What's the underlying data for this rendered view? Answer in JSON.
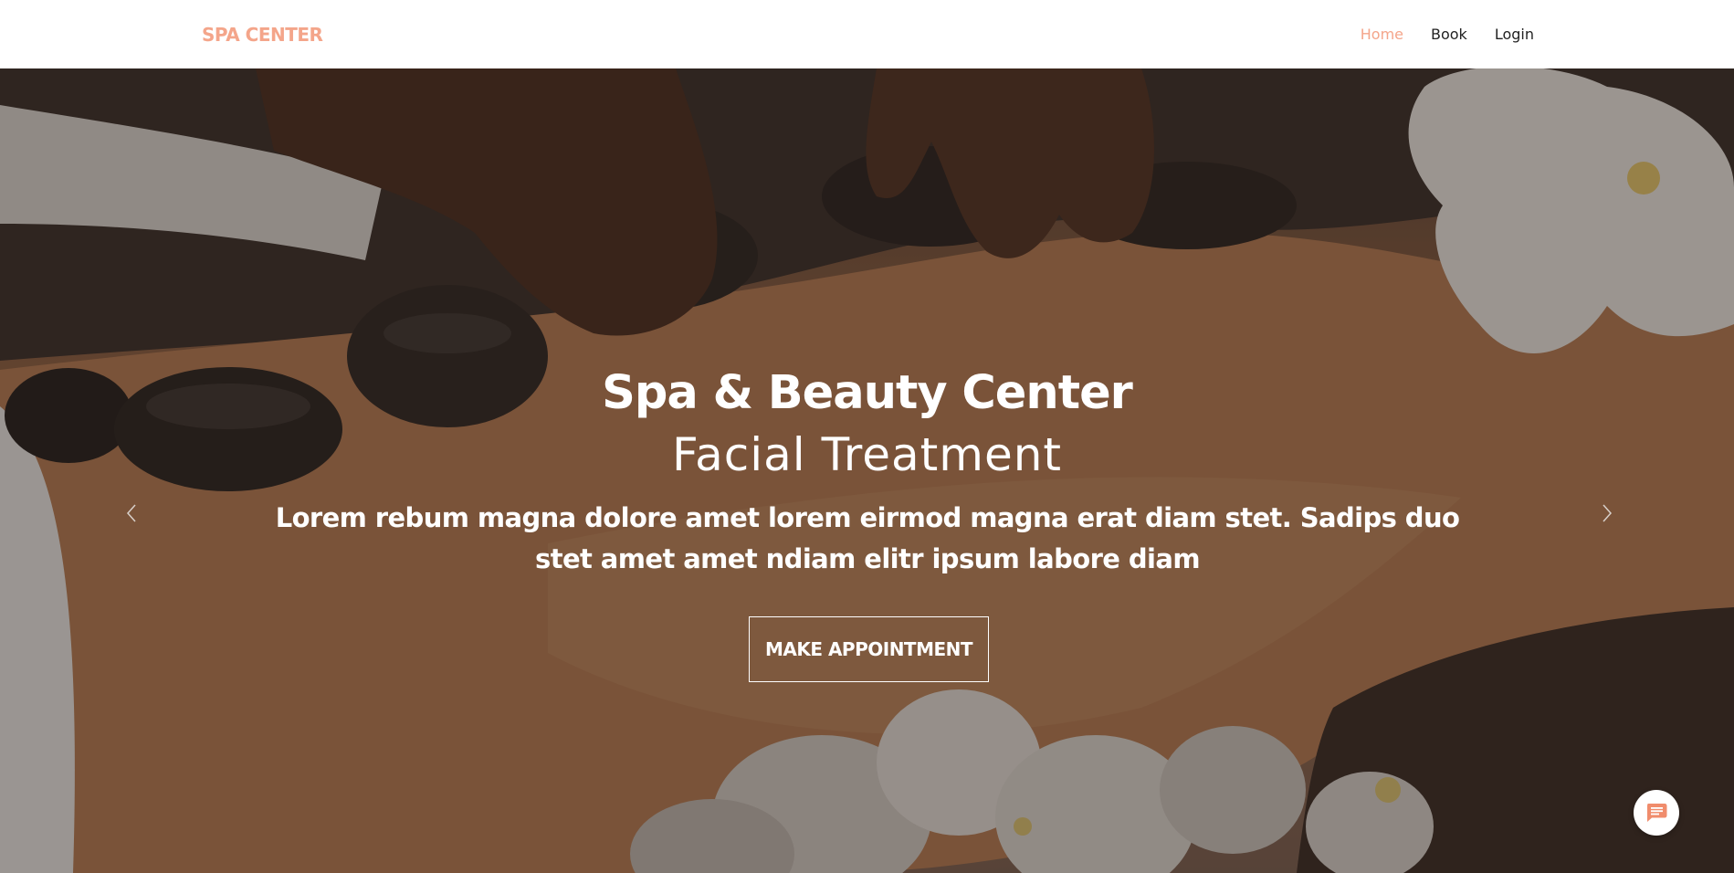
{
  "navbar": {
    "brand": "SPA CENTER",
    "links": [
      {
        "label": "Home",
        "active": true
      },
      {
        "label": "Book",
        "active": false
      },
      {
        "label": "Login",
        "active": false
      }
    ]
  },
  "hero": {
    "title": "Spa & Beauty Center",
    "subtitle": "Facial Treatment",
    "text": "Lorem rebum magna dolore amet lorem eirmod magna erat diam stet. Sadips duo stet amet amet ndiam elitr ipsum labore diam",
    "button_label": "MAKE APPOINTMENT"
  },
  "icons": {
    "prev": "chevron-left-icon",
    "next": "chevron-right-icon",
    "chat": "chat-icon"
  },
  "colors": {
    "accent": "#f4a58a",
    "nav_text": "#222222",
    "hero_text": "#ffffff"
  }
}
